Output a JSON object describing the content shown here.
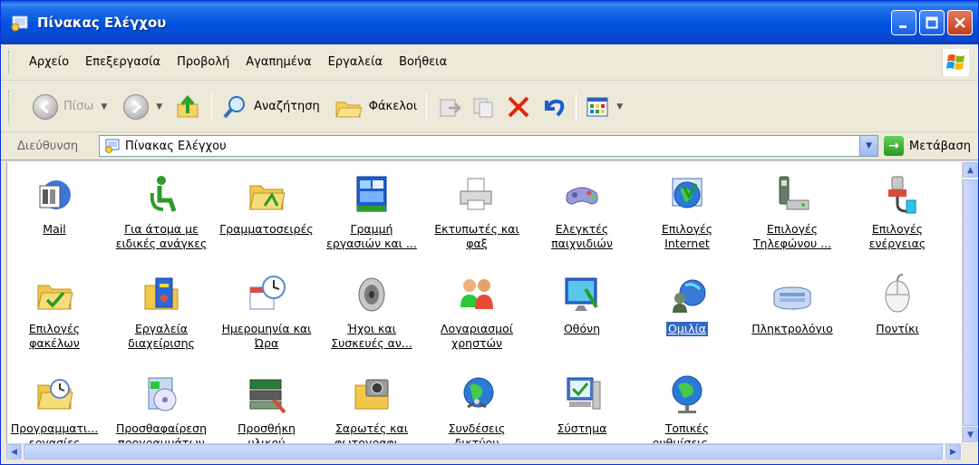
{
  "window": {
    "title": "Πίνακας Ελέγχου"
  },
  "menu": [
    "Αρχείο",
    "Επεξεργασία",
    "Προβολή",
    "Αγαπημένα",
    "Εργαλεία",
    "Βοήθεια"
  ],
  "toolbar": {
    "back": "Πίσω",
    "search": "Αναζήτηση",
    "folders": "Φάκελοι"
  },
  "address": {
    "label": "Διεύθυνση",
    "value": "Πίνακας Ελέγχου",
    "go": "Μετάβαση"
  },
  "items": [
    {
      "l1": "Mail",
      "l2": "",
      "icon": "mail-icon"
    },
    {
      "l1": "Για άτομα με",
      "l2": "ειδικές ανάγκες",
      "icon": "accessibility-icon"
    },
    {
      "l1": "Γραμματοσειρές",
      "l2": "",
      "icon": "fonts-folder-icon"
    },
    {
      "l1": "Γραμμή",
      "l2": "εργασιών και ...",
      "icon": "taskbar-icon"
    },
    {
      "l1": "Εκτυπωτές και",
      "l2": "φαξ",
      "icon": "printer-icon"
    },
    {
      "l1": "Ελεγκτές",
      "l2": "παιχνιδιών",
      "icon": "gamepad-icon"
    },
    {
      "l1": "Επιλογές",
      "l2": "Internet",
      "icon": "internet-globe-icon"
    },
    {
      "l1": "Επιλογές",
      "l2": "Τηλεφώνου ...",
      "icon": "phone-modem-icon"
    },
    {
      "l1": "Επιλογές",
      "l2": "ενέργειας",
      "icon": "power-plug-icon"
    },
    {
      "l1": "Επιλογές",
      "l2": "φακέλων",
      "icon": "folder-options-icon"
    },
    {
      "l1": "Εργαλεία",
      "l2": "διαχείρισης",
      "icon": "admin-tools-icon"
    },
    {
      "l1": "Ημερομηνία και",
      "l2": "Ώρα",
      "icon": "date-time-icon"
    },
    {
      "l1": "Ήχοι και",
      "l2": "Συσκευές αν...",
      "icon": "speaker-icon"
    },
    {
      "l1": "Λογαριασμοί",
      "l2": "χρηστών",
      "icon": "users-icon"
    },
    {
      "l1": "Οθόνη",
      "l2": "",
      "icon": "display-icon"
    },
    {
      "l1": "Ομιλία",
      "l2": "",
      "icon": "speech-icon",
      "selected": true
    },
    {
      "l1": "Πληκτρολόγιο",
      "l2": "",
      "icon": "keyboard-icon"
    },
    {
      "l1": "Ποντίκι",
      "l2": "",
      "icon": "mouse-icon"
    },
    {
      "l1": "Προγραμματι...",
      "l2": "εργασίες",
      "icon": "scheduled-tasks-icon"
    },
    {
      "l1": "Προσθαφαίρεση",
      "l2": "προγραμμάτων",
      "icon": "add-remove-icon"
    },
    {
      "l1": "Προσθήκη",
      "l2": "υλικού",
      "icon": "add-hardware-icon"
    },
    {
      "l1": "Σαρωτές και",
      "l2": "φωτογραφι...",
      "icon": "scanner-camera-icon"
    },
    {
      "l1": "Συνδέσεις",
      "l2": "δικτύου",
      "icon": "network-icon"
    },
    {
      "l1": "Σύστημα",
      "l2": "",
      "icon": "system-icon"
    },
    {
      "l1": "Τοπικές",
      "l2": "ρυθμίσεις ...",
      "icon": "regional-globe-icon"
    }
  ]
}
